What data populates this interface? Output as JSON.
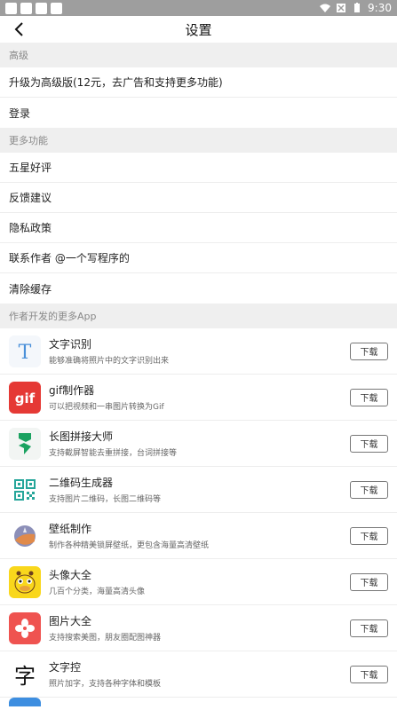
{
  "status": {
    "time": "9:30"
  },
  "header": {
    "title": "设置"
  },
  "sections": {
    "advanced": "高级",
    "more": "更多功能",
    "apps": "作者开发的更多App"
  },
  "advanced_items": [
    {
      "label": "升级为高级版(12元，去广告和支持更多功能)"
    },
    {
      "label": "登录"
    }
  ],
  "more_items": [
    {
      "label": "五星好评"
    },
    {
      "label": "反馈建议"
    },
    {
      "label": "隐私政策"
    },
    {
      "label": "联系作者 @一个写程序的"
    },
    {
      "label": "清除缓存"
    }
  ],
  "apps": [
    {
      "name": "文字识别",
      "desc": "能够准确将照片中的文字识别出来",
      "icon": "text-recognition-icon",
      "button": "下载"
    },
    {
      "name": "gif制作器",
      "desc": "可以把视频和一串图片转换为Gif",
      "icon": "gif-maker-icon",
      "button": "下载"
    },
    {
      "name": "长图拼接大师",
      "desc": "支持截屏智能去重拼接，台词拼接等",
      "icon": "long-image-stitch-icon",
      "button": "下载"
    },
    {
      "name": "二维码生成器",
      "desc": "支持图片二维码，长图二维码等",
      "icon": "qr-generator-icon",
      "button": "下载"
    },
    {
      "name": "壁纸制作",
      "desc": "制作各种精美锁屏壁纸，更包含海量高清壁纸",
      "icon": "wallpaper-icon",
      "button": "下载"
    },
    {
      "name": "头像大全",
      "desc": "几百个分类，海量高清头像",
      "icon": "giraffe-avatar-icon",
      "button": "下载"
    },
    {
      "name": "图片大全",
      "desc": "支持搜索美图，朋友圈配图神器",
      "icon": "flower-pictures-icon",
      "button": "下载"
    },
    {
      "name": "文字控",
      "desc": "照片加字，支持各种字体和模板",
      "icon": "text-control-icon",
      "icon_glyph": "字",
      "button": "下载"
    }
  ],
  "colors": {
    "statusbar": "#9e9e9e",
    "section_bg": "#efefef",
    "gif_red": "#e53935",
    "stitch_green": "#1aa260",
    "qr_green": "#26a69a",
    "giraffe_yellow": "#f9d71c",
    "flower_red": "#ef5350"
  }
}
